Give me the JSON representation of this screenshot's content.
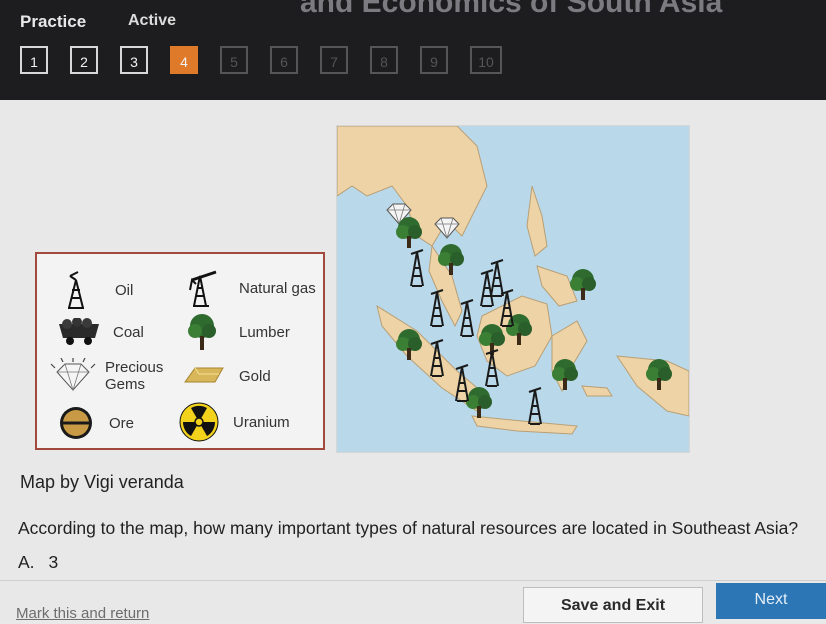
{
  "header": {
    "page_title": "and Economics of South Asia",
    "modes": [
      "Practice",
      "Active"
    ],
    "question_numbers": [
      "1",
      "2",
      "3",
      "4",
      "5",
      "6",
      "7",
      "8",
      "9",
      "10"
    ],
    "current_question": "4"
  },
  "legend": {
    "items": [
      {
        "label": "Oil",
        "icon": "oil-derrick-icon"
      },
      {
        "label": "Natural gas",
        "icon": "gas-derrick-icon"
      },
      {
        "label": "Coal",
        "icon": "coal-cart-icon"
      },
      {
        "label": "Lumber",
        "icon": "tree-icon"
      },
      {
        "label": "Precious Gems",
        "icon": "diamond-icon"
      },
      {
        "label": "Gold",
        "icon": "gold-bar-icon"
      },
      {
        "label": "Ore",
        "icon": "ore-disc-icon"
      },
      {
        "label": "Uranium",
        "icon": "radiation-icon"
      }
    ]
  },
  "caption": "Map by Vigi veranda",
  "question": "According to the map, how many important types of natural resources are located in Southeast Asia?",
  "answer": {
    "letter": "A.",
    "value": "3"
  },
  "footer": {
    "mark_link": "Mark this and return",
    "save_label": "Save and Exit",
    "next_label": "Next"
  },
  "colors": {
    "accent": "#e07a2b",
    "next_button": "#2d76b6",
    "legend_border": "#a2483c",
    "sea": "#b9d9ea",
    "land": "#eed3a6"
  }
}
